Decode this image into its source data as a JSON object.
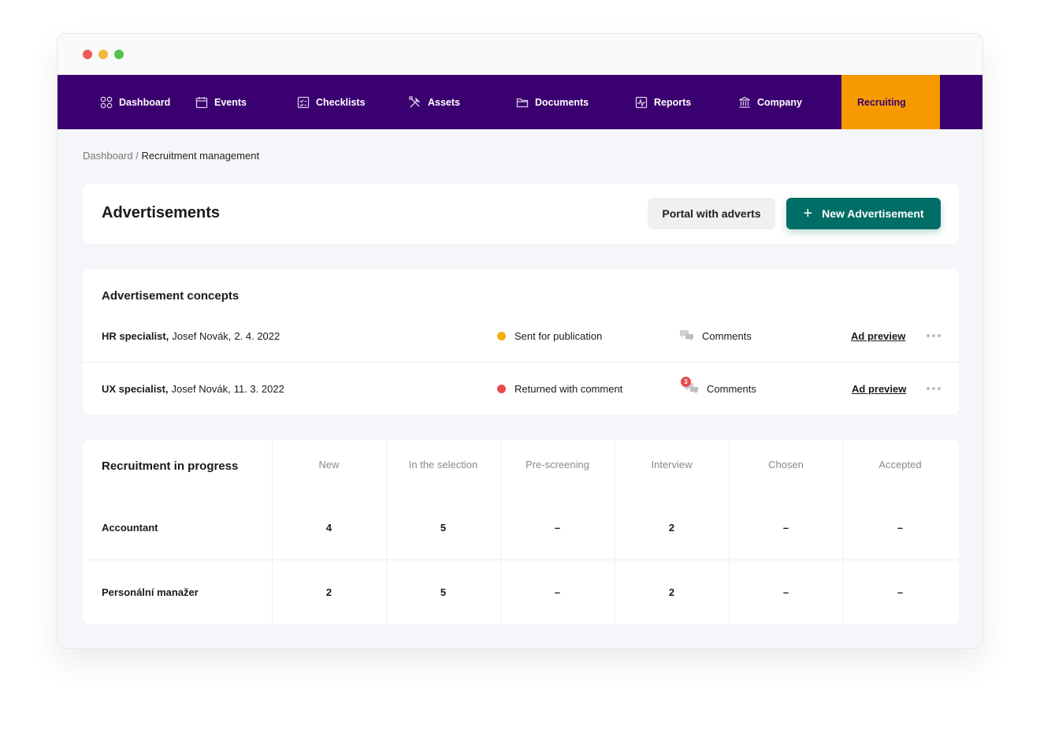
{
  "nav": {
    "items": [
      {
        "label": "Dashboard",
        "icon": "dashboard-icon"
      },
      {
        "label": "Events",
        "icon": "calendar-icon"
      },
      {
        "label": "Checklists",
        "icon": "checklist-icon"
      },
      {
        "label": "Assets",
        "icon": "tools-icon"
      },
      {
        "label": "Documents",
        "icon": "folder-icon"
      },
      {
        "label": "Reports",
        "icon": "chart-icon"
      },
      {
        "label": "Company",
        "icon": "building-icon"
      },
      {
        "label": "Recruiting",
        "icon": ""
      }
    ],
    "active": "Recruiting",
    "colors": {
      "bar": "#3b0070",
      "active": "#f79a00"
    }
  },
  "breadcrumb": {
    "root": "Dashboard",
    "separator": "/",
    "current": "Recruitment management"
  },
  "header": {
    "title": "Advertisements",
    "portal_button": "Portal with adverts",
    "new_button": "New Advertisement",
    "new_button_color": "#006e66"
  },
  "concepts": {
    "title": "Advertisement concepts",
    "rows": [
      {
        "job": "HR specialist,",
        "author": "Josef Novák,",
        "date": "2. 4. 2022",
        "status": "Sent for publication",
        "status_color": "#f4ac0b",
        "comments_label": "Comments",
        "comment_count": "",
        "link": "Ad preview"
      },
      {
        "job": "UX specialist,",
        "author": "Josef Novák,",
        "date": "11. 3. 2022",
        "status": "Returned with comment",
        "status_color": "#e94b4b",
        "comments_label": "Comments",
        "comment_count": "3",
        "link": "Ad preview"
      }
    ]
  },
  "progress": {
    "title": "Recruitment in progress",
    "columns": [
      "New",
      "In the selection",
      "Pre-screening",
      "Interview",
      "Chosen",
      "Accepted"
    ],
    "rows": [
      {
        "label": "Accountant",
        "values": [
          "4",
          "5",
          "–",
          "2",
          "–",
          "–"
        ]
      },
      {
        "label": "Personální manažer",
        "values": [
          "2",
          "5",
          "–",
          "2",
          "–",
          "–"
        ]
      }
    ]
  }
}
